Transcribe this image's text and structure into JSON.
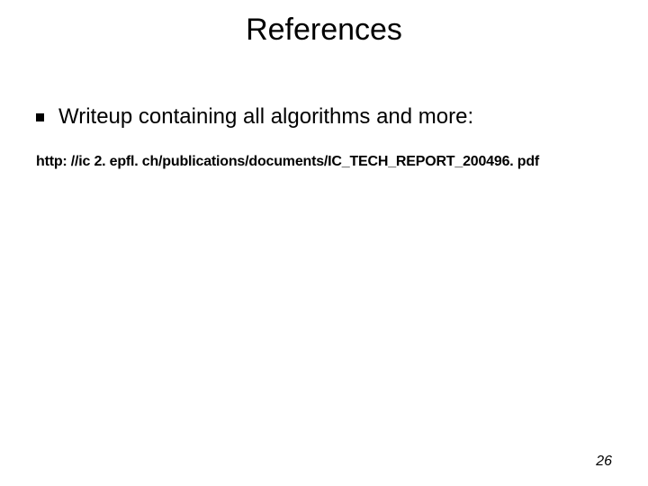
{
  "title": "References",
  "bullet1": "Writeup containing all algorithms and more:",
  "link": "http: //ic 2. epfl. ch/publications/documents/IC_TECH_REPORT_200496. pdf",
  "page_number": "26"
}
